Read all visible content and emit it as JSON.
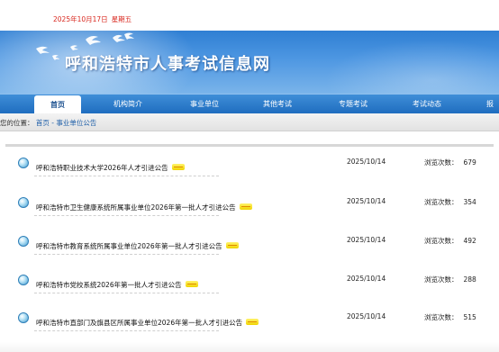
{
  "topbar": {
    "date": "2025年10月17日",
    "weekday": "星期五"
  },
  "header": {
    "site_title": "呼和浩特市人事考试信息网"
  },
  "nav": {
    "items": [
      {
        "label": "首页",
        "active": true
      },
      {
        "label": "机构简介",
        "active": false
      },
      {
        "label": "事业单位",
        "active": false
      },
      {
        "label": "其他考试",
        "active": false
      },
      {
        "label": "专题考试",
        "active": false
      },
      {
        "label": "考试动态",
        "active": false
      },
      {
        "label": "报",
        "active": false
      }
    ]
  },
  "breadcrumb": {
    "prefix": "您的位置：",
    "home": "首页",
    "separator": "-",
    "current": "事业单位公告"
  },
  "list": {
    "views_label": "浏览次数：",
    "items": [
      {
        "title": "呼和浩特职业技术大学2026年人才引进公告",
        "date": "2025/10/14",
        "views": "679",
        "is_new": true
      },
      {
        "title": "呼和浩特市卫生健康系统所属事业单位2026年第一批人才引进公告",
        "date": "2025/10/14",
        "views": "354",
        "is_new": true
      },
      {
        "title": "呼和浩特市教育系统所属事业单位2026年第一批人才引进公告",
        "date": "2025/10/14",
        "views": "492",
        "is_new": true
      },
      {
        "title": "呼和浩特市党校系统2026年第一批人才引进公告",
        "date": "2025/10/14",
        "views": "288",
        "is_new": true
      },
      {
        "title": "呼和浩特市直部门及旗县区所属事业单位2026年第一批人才引进公告",
        "date": "2025/10/14",
        "views": "515",
        "is_new": true
      }
    ]
  },
  "colors": {
    "date_red": "#d9281f",
    "banner_blue": "#2f7fd3",
    "nav_blue": "#1f6dbf",
    "link_blue": "#1f5fa8",
    "new_badge_yellow": "#f0d400"
  },
  "icons": {
    "bullet": "globe-bullet-icon",
    "new_badge": "new-badge-icon",
    "birds": "doves-decoration"
  }
}
